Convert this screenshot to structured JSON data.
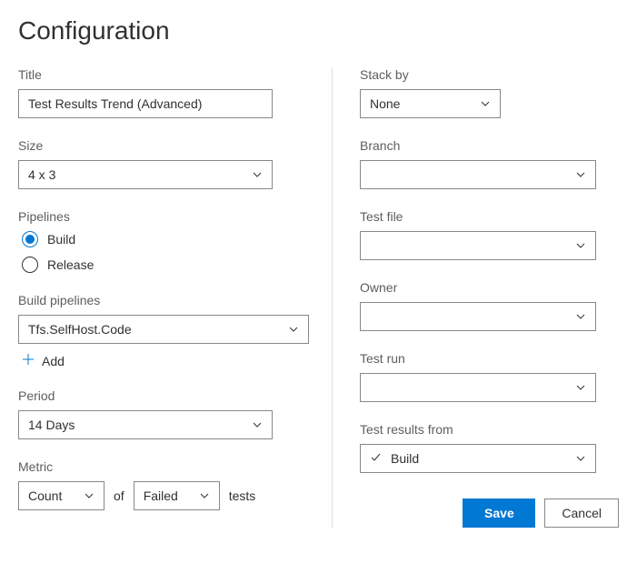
{
  "header": {
    "title": "Configuration"
  },
  "left": {
    "title_label": "Title",
    "title_value": "Test Results Trend (Advanced)",
    "size_label": "Size",
    "size_value": "4 x 3",
    "pipelines_label": "Pipelines",
    "pipelines_options": {
      "build": "Build",
      "release": "Release"
    },
    "pipelines_selected": "build",
    "build_pipelines_label": "Build pipelines",
    "build_pipelines_value": "Tfs.SelfHost.Code",
    "add_label": "Add",
    "period_label": "Period",
    "period_value": "14 Days",
    "metric_label": "Metric",
    "metric_count": "Count",
    "metric_of": "of",
    "metric_failed": "Failed",
    "metric_tests": "tests"
  },
  "right": {
    "stack_by_label": "Stack by",
    "stack_by_value": "None",
    "branch_label": "Branch",
    "branch_value": "",
    "test_file_label": "Test file",
    "test_file_value": "",
    "owner_label": "Owner",
    "owner_value": "",
    "test_run_label": "Test run",
    "test_run_value": "",
    "results_from_label": "Test results from",
    "results_from_value": "Build"
  },
  "buttons": {
    "save": "Save",
    "cancel": "Cancel"
  }
}
